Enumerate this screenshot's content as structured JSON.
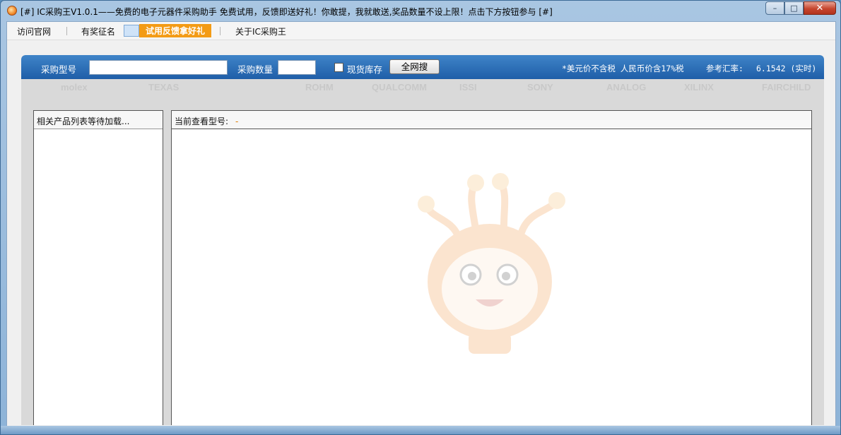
{
  "window": {
    "title": "[#] IC采购王V1.0.1——免费的电子元器件采购助手  免费试用，反馈即送好礼！你敢提，我就敢送,奖品数量不设上限！点击下方按钮参与 [#]",
    "min_glyph": "–",
    "max_glyph": "□",
    "close_glyph": "✕"
  },
  "menu": {
    "items": [
      {
        "label": "访问官网"
      },
      {
        "label": "有奖征名"
      },
      {
        "label": "试用反馈拿好礼"
      },
      {
        "label": "关于IC采购王"
      }
    ]
  },
  "search": {
    "model_label": "采购型号",
    "model_value": "",
    "qty_label": "采购数量",
    "qty_value": "",
    "stock_label": "现货库存",
    "stock_checked": false,
    "search_button": "全网搜",
    "tax_note": "*美元价不含税 人民币价含17%税",
    "rate_label": "参考汇率:",
    "rate_value": "6.1542 (实时)"
  },
  "brands": [
    "molex",
    "TEXAS",
    "ROHM",
    "QUALCOMM",
    "ISSI",
    "SONY",
    "ANALOG",
    "XILINX",
    "FAIRCHILD"
  ],
  "left_pane": {
    "header": "相关产品列表等待加载..."
  },
  "right_pane": {
    "header_label": "当前查看型号:",
    "header_value": "-"
  },
  "colors": {
    "accent": "#f39b15",
    "search_bar": "#1f5ea8"
  }
}
